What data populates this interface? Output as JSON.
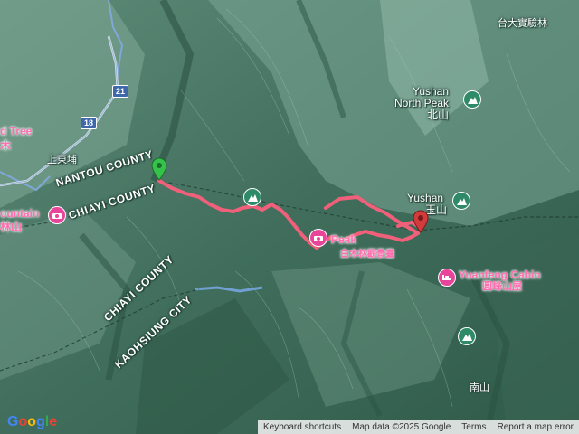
{
  "regions": {
    "nantou": "NANTOU COUNTY",
    "chiayi_top": "CHIAYI COUNTY",
    "chiayi_bottom": "CHIAYI COUNTY",
    "kaohsiung": "KAOHSIUNG CITY"
  },
  "places": {
    "experimental_forest": "台大實驗林",
    "shangdongpu": "上東埔",
    "nanshan": "南山",
    "tree_partial": "d Tree",
    "tree_partial_zh": "木",
    "mountain_partial": "ountain",
    "mountain_partial_zh": "林山"
  },
  "pois": {
    "yushan_north_en": "Yushan\nNorth Peak",
    "yushan_north_zh": "北山",
    "yushan_en": "Yushan",
    "yushan_zh": "玉山",
    "yuanfeng_en": "Yuanfeng Cabin",
    "yuanfeng_zh": "圓峰山屋",
    "peak_partial": "Peak",
    "baimu_zh": "白木林觀景臺"
  },
  "roads": [
    "21",
    "18"
  ],
  "footer": {
    "logo": "Google",
    "shortcuts": "Keyboard shortcuts",
    "map_data": "Map data ©2025 Google",
    "terms": "Terms",
    "report": "Report a map error"
  },
  "colors": {
    "route": "#f0607a",
    "start_pin": "#35c24a",
    "end_pin": "#d23b3b",
    "poi_green": "#2f8a67",
    "poi_pink": "#e8449a"
  },
  "icons": {
    "start": "start-pin-icon",
    "end": "end-pin-icon",
    "mountain": "mountain-icon",
    "lodging": "bed-icon",
    "viewpoint": "camera-icon"
  }
}
